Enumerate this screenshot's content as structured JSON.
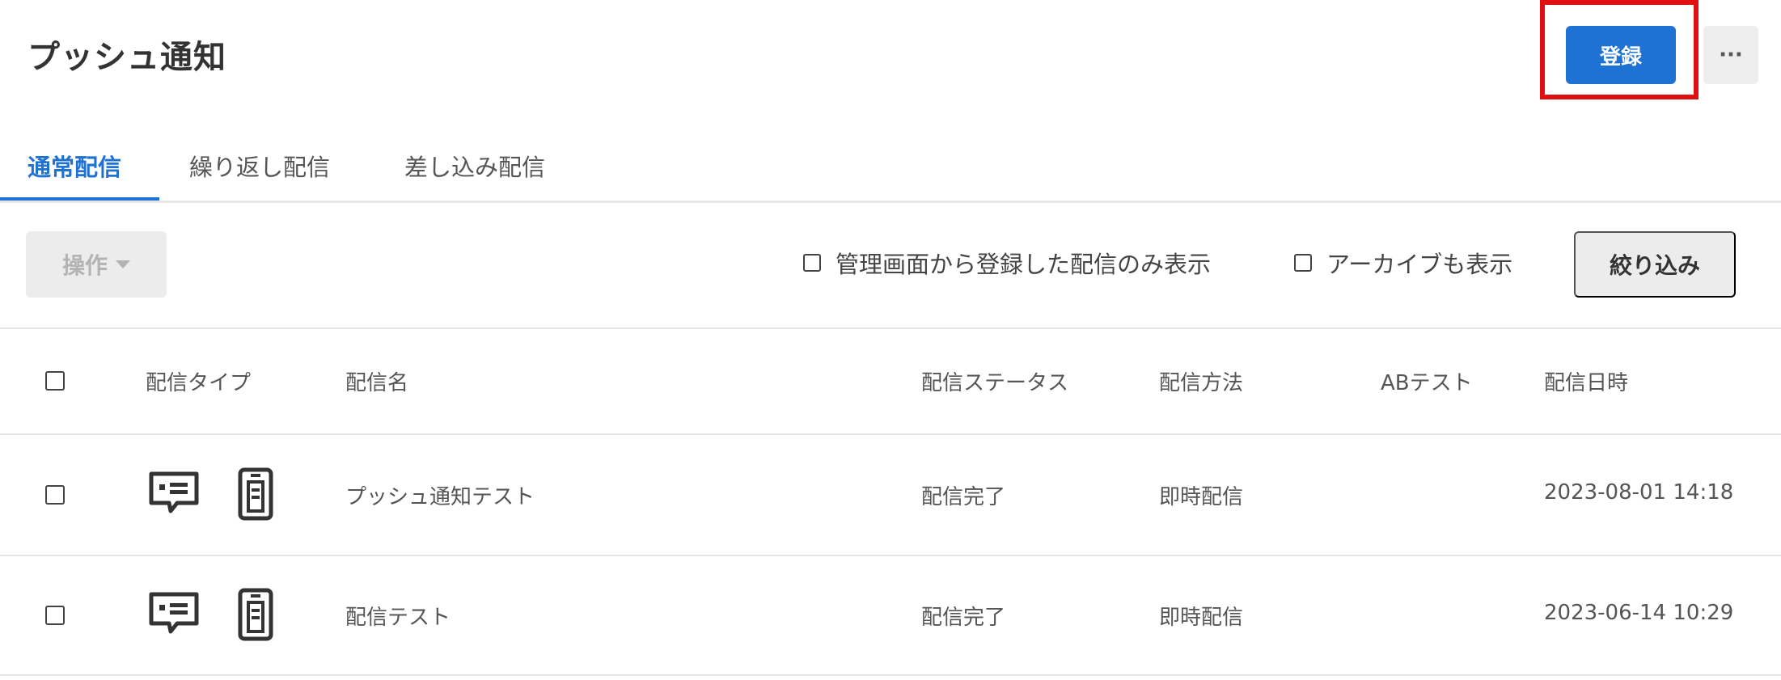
{
  "header": {
    "title": "プッシュ通知",
    "register_label": "登録",
    "more_label": "···"
  },
  "tabs": [
    {
      "label": "通常配信",
      "active": true
    },
    {
      "label": "繰り返し配信",
      "active": false
    },
    {
      "label": "差し込み配信",
      "active": false
    }
  ],
  "toolbar": {
    "operations_label": "操作",
    "filter_admin_only_label": "管理画面から登録した配信のみ表示",
    "filter_show_archive_label": "アーカイブも表示",
    "filter_button_label": "絞り込み"
  },
  "table": {
    "columns": [
      "配信タイプ",
      "配信名",
      "配信ステータス",
      "配信方法",
      "ABテスト",
      "配信日時"
    ],
    "rows": [
      {
        "name": "プッシュ通知テスト",
        "status": "配信完了",
        "method": "即時配信",
        "ab_test": "",
        "datetime": "2023-08-01 14:18",
        "type_icons": [
          "message-icon",
          "smartphone-icon"
        ]
      },
      {
        "name": "配信テスト",
        "status": "配信完了",
        "method": "即時配信",
        "ab_test": "",
        "datetime": "2023-06-14 10:29",
        "type_icons": [
          "message-icon",
          "smartphone-icon"
        ]
      }
    ]
  },
  "colors": {
    "accent": "#1d72d3",
    "highlight": "#e01010"
  }
}
